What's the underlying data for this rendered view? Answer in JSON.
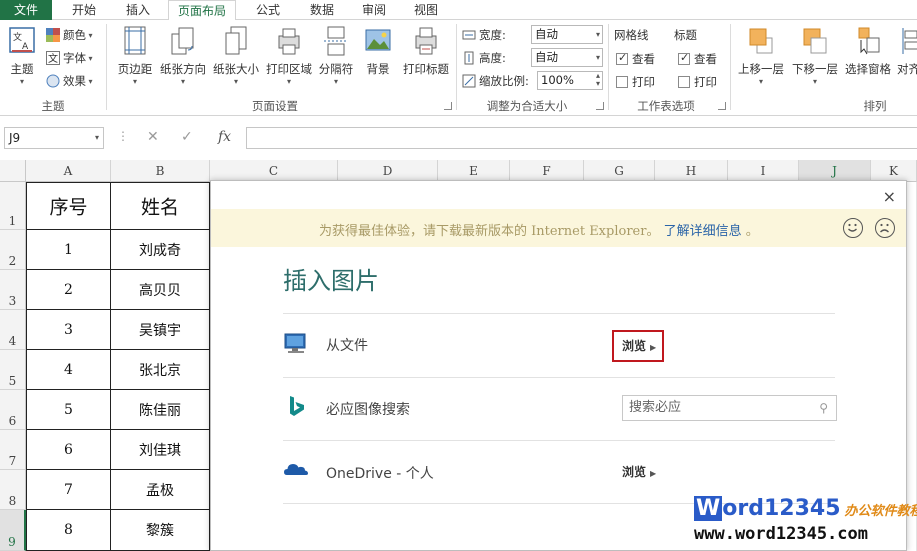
{
  "ribbon": {
    "tabs": [
      {
        "label": "文件"
      },
      {
        "label": "开始"
      },
      {
        "label": "插入"
      },
      {
        "label": "页面布局"
      },
      {
        "label": "公式"
      },
      {
        "label": "数据"
      },
      {
        "label": "审阅"
      },
      {
        "label": "视图"
      }
    ],
    "active_tab": "页面布局",
    "themes": {
      "theme_label": "主题",
      "colors_label": "颜色",
      "fonts_label": "字体",
      "effects_label": "效果",
      "group_label": "主题"
    },
    "page_setup": {
      "margins": "页边距",
      "orientation": "纸张方向",
      "size": "纸张大小",
      "print_area": "打印区域",
      "breaks": "分隔符",
      "background": "背景",
      "print_titles": "打印标题",
      "group_label": "页面设置"
    },
    "scale_to_fit": {
      "width_label": "宽度:",
      "width_value": "自动",
      "height_label": "高度:",
      "height_value": "自动",
      "scale_label": "缩放比例:",
      "scale_value": "100%",
      "group_label": "调整为合适大小"
    },
    "sheet_options": {
      "gridlines_label": "网格线",
      "headings_label": "标题",
      "view_label": "查看",
      "print_label": "打印",
      "group_label": "工作表选项"
    },
    "arrange": {
      "bring_forward": "上移一层",
      "send_backward": "下移一层",
      "selection_pane": "选择窗格",
      "align": "对齐",
      "group_label": "排列"
    }
  },
  "formula_bar": {
    "name_box": "J9",
    "fx": "fx",
    "formula": ""
  },
  "sheet": {
    "columns": [
      "A",
      "B",
      "C",
      "D",
      "E",
      "F",
      "G",
      "H",
      "I",
      "J",
      "K"
    ],
    "selected_column": "J",
    "rows": [
      "1",
      "2",
      "3",
      "4",
      "5",
      "6",
      "7",
      "8",
      "9"
    ],
    "selected_row": "9",
    "header": {
      "col_a": "序号",
      "col_b": "姓名"
    },
    "data": [
      {
        "no": "1",
        "name": "刘成奇"
      },
      {
        "no": "2",
        "name": "高贝贝"
      },
      {
        "no": "3",
        "name": "吴镇宇"
      },
      {
        "no": "4",
        "name": "张北京"
      },
      {
        "no": "5",
        "name": "陈佳丽"
      },
      {
        "no": "6",
        "name": "刘佳琪"
      },
      {
        "no": "7",
        "name": "孟极"
      },
      {
        "no": "8",
        "name": "黎簇"
      }
    ]
  },
  "dialog": {
    "close": "×",
    "ie_message": "为获得最佳体验，请下载最新版本的 Internet Explorer。",
    "ie_link": "了解详细信息",
    "ie_link_suffix": "。",
    "title": "插入图片",
    "from_file": {
      "label": "从文件",
      "action": "浏览"
    },
    "bing": {
      "label": "必应图像搜索",
      "placeholder": "搜索必应"
    },
    "onedrive": {
      "label": "OneDrive - 个人",
      "action": "浏览"
    }
  },
  "watermark": {
    "brand_first": "W",
    "brand_rest": "ord12345",
    "brand_cn": "办公软件教程",
    "url": "www.word12345.com"
  },
  "colors": {
    "excel_green": "#217346",
    "dialog_title": "#2e6e6b",
    "highlight_red": "#c0181e",
    "ie_bar": "#fbf6dc"
  }
}
